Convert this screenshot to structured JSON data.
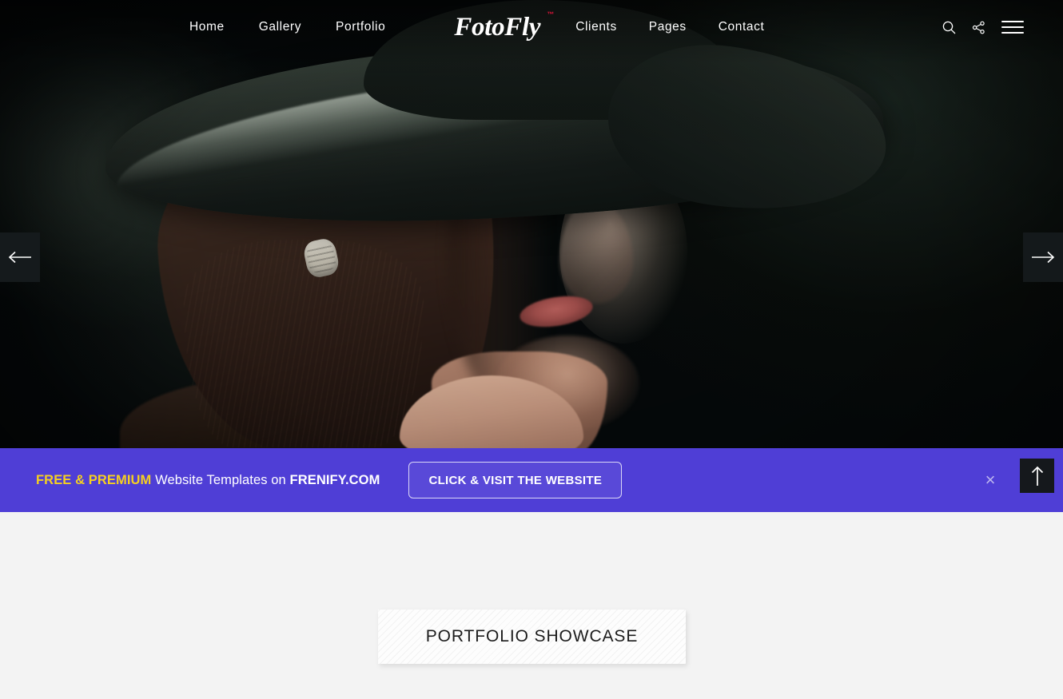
{
  "header": {
    "brand": "FotoFly",
    "brand_tm": "™",
    "nav_left": [
      {
        "label": "Home"
      },
      {
        "label": "Gallery"
      },
      {
        "label": "Portfolio"
      }
    ],
    "nav_right": [
      {
        "label": "Clients"
      },
      {
        "label": "Pages"
      },
      {
        "label": "Contact"
      }
    ],
    "icons": {
      "search": "search-icon",
      "share": "share-icon",
      "menu": "hamburger-menu-icon"
    }
  },
  "hero": {
    "alt": "Portrait of a young girl wearing a wide-brimmed dark hat against a dark green backdrop",
    "prev_label": "Previous slide",
    "next_label": "Next slide"
  },
  "promo": {
    "highlight": "FREE & PREMIUM",
    "middle": " Website Templates on ",
    "domain": "FRENIFY.COM",
    "button_label": "CLICK & VISIT THE WEBSITE",
    "close_label": "×",
    "bar_color": "#4f3ed6",
    "highlight_color": "#f5d020"
  },
  "scroll_top": {
    "label": "Back to top"
  },
  "content": {
    "showcase_title": "PORTFOLIO SHOWCASE"
  }
}
